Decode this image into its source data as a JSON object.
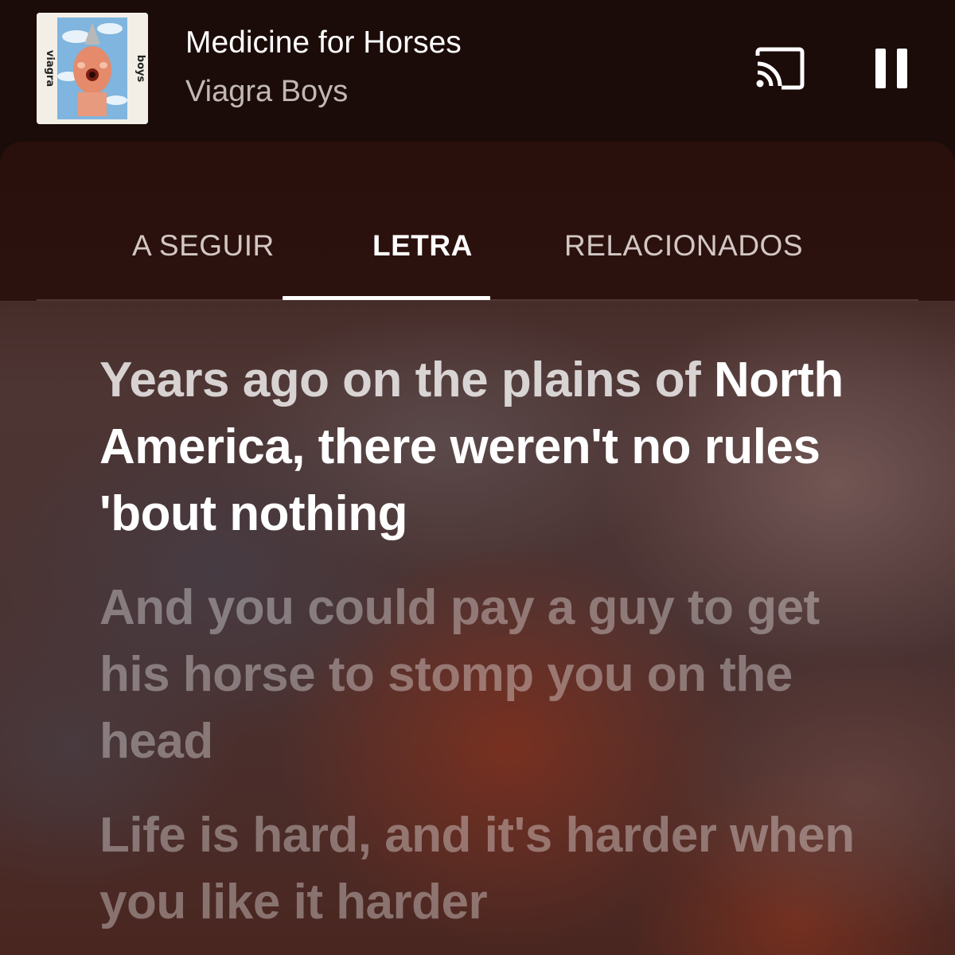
{
  "now_playing": {
    "title": "Medicine for Horses",
    "artist": "Viagra Boys",
    "album_art_text_left": "viagra",
    "album_art_text_right": "boys"
  },
  "controls": {
    "cast_icon": "cast-icon",
    "pause_icon": "pause-icon"
  },
  "tabs": [
    {
      "label": "A SEGUIR",
      "active": false
    },
    {
      "label": "LETRA",
      "active": true
    },
    {
      "label": "RELACIONADOS",
      "active": false
    }
  ],
  "lyrics": {
    "sung_fragment": "Years ago on the plains of",
    "current_fragment": "North America, there weren't no rules 'bout nothing",
    "upcoming": [
      "And you could pay a guy to get his horse to stomp you on the head",
      "Life is hard, and it's harder when you like it harder"
    ]
  },
  "colors": {
    "header_bg": "#1b0c09",
    "active_text": "#ffffff",
    "inactive_tab": "#d2c7c4",
    "artist_text": "#c2b8b5"
  }
}
